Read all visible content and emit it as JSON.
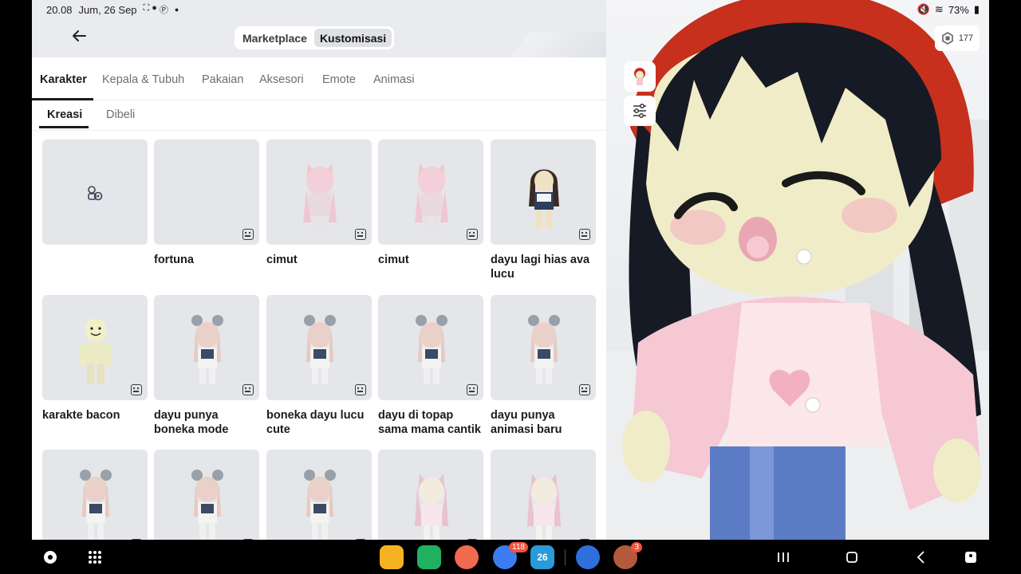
{
  "status": {
    "time": "20.08",
    "date": "Jum, 26 Sep",
    "battery": "73%"
  },
  "header": {
    "segments": [
      "Marketplace",
      "Kustomisasi"
    ],
    "active_segment": "Kustomisasi"
  },
  "tabs": [
    "Karakter",
    "Kepala & Tubuh",
    "Pakaian",
    "Aksesori",
    "Emote",
    "Animasi"
  ],
  "subtabs": [
    "Kreasi",
    "Dibeli"
  ],
  "items": [
    {
      "title": "",
      "kind": "create"
    },
    {
      "title": "fortuna",
      "kind": "empty"
    },
    {
      "title": "cimut",
      "kind": "pinkcat"
    },
    {
      "title": "cimut",
      "kind": "pinkcat"
    },
    {
      "title": "dayu lagi hias ava lucu",
      "kind": "brown"
    },
    {
      "title": "karakte bacon",
      "kind": "bacon"
    },
    {
      "title": "dayu punya boneka mode",
      "kind": "mouse"
    },
    {
      "title": "boneka dayu lucu cute",
      "kind": "mouse"
    },
    {
      "title": "dayu di topap sama mama cantik",
      "kind": "mouse"
    },
    {
      "title": "dayu punya animasi baru",
      "kind": "mouse"
    },
    {
      "title": "",
      "kind": "mouse"
    },
    {
      "title": "",
      "kind": "mouse"
    },
    {
      "title": "",
      "kind": "mouse"
    },
    {
      "title": "",
      "kind": "pinkcat2"
    },
    {
      "title": "",
      "kind": "pinkcat2"
    }
  ],
  "robux": {
    "amount": "177"
  },
  "nav": {
    "badge_messages": "118",
    "badge_calendar": "26",
    "badge_game": "3"
  },
  "colors": {
    "accent_text": "#1b1c1e",
    "card_bg": "#e4e6e9",
    "header_bg": "#e9ebee"
  }
}
